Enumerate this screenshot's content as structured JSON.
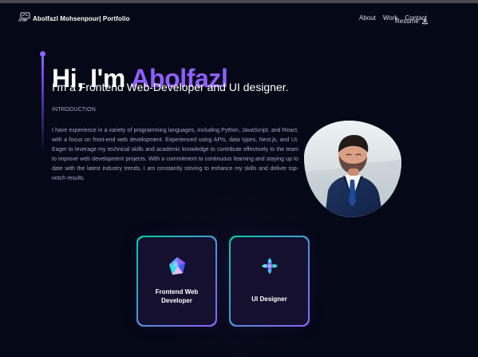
{
  "navbar": {
    "logo_text": "Artin",
    "brand": "Abolfazl Mohsenpour| Portfolio",
    "links": [
      "About",
      "Work",
      "Contact"
    ],
    "resume": "Resume"
  },
  "hero": {
    "greeting": "Hi, I'm ",
    "name": "Abolfazl",
    "subtitle": "I'm a Frontend Web-Developer and UI designer.",
    "intro_label": "INTRODUCTION",
    "intro_text": "I have experience in a variety of programming languages, including Python, JavaScript, and React, with a focus on front-end web development. Experienced using APIs, data types, Next.js, and UI. Eager to leverage my technical skills and academic knowledge to contribute effectively to the team to improve web development projects. With a commitment to continuous learning and staying up to date with the latest industry trends, I am constantly striving to enhance my skills and deliver top-notch results."
  },
  "services": [
    {
      "label": "Frontend Web\nDeveloper",
      "icon": "frontend-icon"
    },
    {
      "label": "UI Designer",
      "icon": "ui-design-icon"
    }
  ],
  "colors": {
    "background": "#050816",
    "accent": "#915eff",
    "card": "#151030",
    "secondary_text": "#aaa6c3",
    "teal": "#00cea8"
  }
}
